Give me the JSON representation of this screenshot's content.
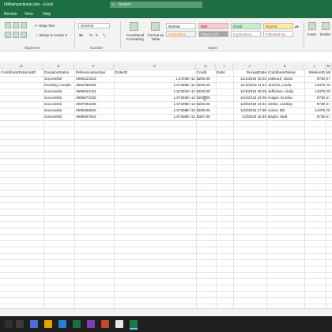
{
  "window": {
    "title": "FMtransactional.xlsx - Excel",
    "search_placeholder": "Search"
  },
  "menu": [
    "Review",
    "View",
    "Help"
  ],
  "ribbon": {
    "wrap_text": "Wrap Text",
    "merge_center": "Merge & Center",
    "number_format": "General",
    "percent": "%",
    "comma": "9",
    "conditional_formatting": "Conditional Formatting",
    "format_as_table": "Format as Table",
    "insert": "Insert",
    "delete": "Delete",
    "group_alignment": "Alignment",
    "group_number": "Number",
    "group_styles": "Styles",
    "styles": [
      {
        "label": "Normal",
        "bg": "#ffffff",
        "fg": "#000000"
      },
      {
        "label": "Bad",
        "bg": "#ffc7ce",
        "fg": "#9c0006"
      },
      {
        "label": "Good",
        "bg": "#c6efce",
        "fg": "#006100"
      },
      {
        "label": "Neutral",
        "bg": "#ffeb9c",
        "fg": "#9c5700"
      },
      {
        "label": "Calculation",
        "bg": "#f2f2f2",
        "fg": "#fa7d00"
      },
      {
        "label": "Check Cell",
        "bg": "#a5a5a5",
        "fg": "#ffffff"
      },
      {
        "label": "Explanatory ...",
        "bg": "#ffffff",
        "fg": "#7f7f7f"
      },
      {
        "label": "Followed Hy...",
        "bg": "#ffffff",
        "fg": "#954f72"
      }
    ]
  },
  "columns": [
    "D",
    "E",
    "F",
    "G",
    "H",
    "I",
    "J",
    "K",
    "L",
    "M"
  ],
  "rows": [
    [
      "ContributorExternalID",
      "DonationStatus",
      "ReferenceNumber",
      "OrderID",
      "",
      "Credit",
      "Debit",
      "ReceiptDate",
      "ContributorName",
      "MissionID",
      "MI"
    ],
    [
      "",
      "Successful",
      "4990123323",
      "",
      "1.5726E+12",
      "$200.00",
      "",
      "11/1/2019 16:23",
      "LeBeouf, Dazie",
      "9738",
      "In"
    ],
    [
      "",
      "Pending Comple",
      "4994788335",
      "",
      "1.57289E+12",
      "$200.00",
      "",
      "11/4/2019 11:21",
      "Jenkins, Linda",
      "14379",
      "Gr"
    ],
    [
      "",
      "Successful",
      "4995623124",
      "",
      "1.57291E+12",
      "$240.00",
      "",
      "11/4/2019 18:29",
      "Jefferson, Vicky",
      "14379",
      "Gr"
    ],
    [
      "",
      "Successful",
      "4995673335",
      "",
      "1.57292E+12",
      "$240.00",
      "",
      "11/4/2019 19:05",
      "Hoppe, Eureka",
      "9738",
      "In"
    ],
    [
      "",
      "Successful",
      "4997281836",
      "",
      "1.57299E+12",
      "$240.00",
      "",
      "11/5/2019 14:34",
      "Zimke, Lindsay",
      "9738",
      "In"
    ],
    [
      "",
      "Successful",
      "4999366832",
      "",
      "1.57308E+12",
      "$200.00",
      "",
      "11/6/2019 17:30",
      "Jones, ED",
      "14379",
      "Gr"
    ],
    [
      "",
      "Successful",
      "4999367943",
      "",
      "1.57308E+12",
      "$367.00",
      "",
      "1/2/2020 18:46",
      "Baylor, Matt",
      "9738",
      "In"
    ]
  ]
}
